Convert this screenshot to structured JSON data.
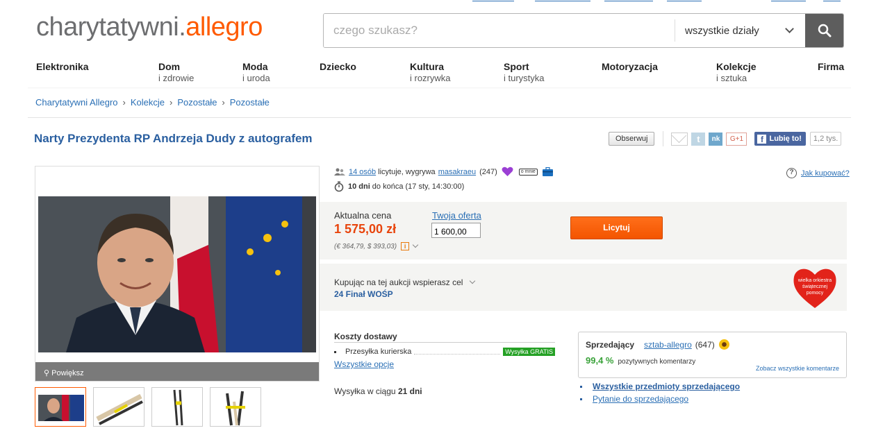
{
  "logo": {
    "part1": "charytatywni.",
    "part2": "allegro"
  },
  "search": {
    "placeholder": "czego szukasz?",
    "department": "wszystkie działy"
  },
  "categories": [
    {
      "title": "Elektronika",
      "sub": ""
    },
    {
      "title": "Dom",
      "sub": "i zdrowie"
    },
    {
      "title": "Moda",
      "sub": "i uroda"
    },
    {
      "title": "Dziecko",
      "sub": ""
    },
    {
      "title": "Kultura",
      "sub": "i rozrywka"
    },
    {
      "title": "Sport",
      "sub": "i turystyka"
    },
    {
      "title": "Motoryzacja",
      "sub": ""
    },
    {
      "title": "Kolekcje",
      "sub": "i sztuka"
    },
    {
      "title": "Firma",
      "sub": ""
    }
  ],
  "breadcrumb": [
    "Charytatywni Allegro",
    "Kolekcje",
    "Pozostałe",
    "Pozostałe"
  ],
  "item": {
    "title": "Narty Prezydenta RP Andrzeja Dudy z autografem"
  },
  "share": {
    "follow": "Obserwuj",
    "twitter": "t",
    "nk": "nk",
    "gplus": "G+1",
    "fb_like": "Lubię to!",
    "fb_count": "1,2 tys."
  },
  "gallery": {
    "zoom": "Powiększ"
  },
  "auction": {
    "bidders": "14 osób",
    "bidders_text": "licytuje, wygrywa",
    "winner": "masakraeu",
    "winner_rating": "(247)",
    "about_me": "o mnie",
    "days": "10 dni",
    "time_text": "do końca (17 sty, 14:30:00)",
    "help": "Jak kupować?"
  },
  "price": {
    "label": "Aktualna cena",
    "value": "1 575,00 zł",
    "converted": "(€ 364,79, $ 393,03)",
    "offer_label": "Twoja oferta",
    "offer_value": "1 600,00",
    "bid_button": "Licytuj"
  },
  "charity": {
    "text": "Kupując na tej aukcji wspierasz cel",
    "cause": "24 Finał WOŚP",
    "logo_text": "wielka orkiestra świątecznej pomocy"
  },
  "shipping": {
    "header": "Koszty dostawy",
    "method": "Przesyłka kurierska",
    "free_badge": "Wysyłka GRATIS",
    "all_options": "Wszystkie opcje",
    "ship_time_prefix": "Wysyłka w ciągu",
    "ship_time_value": "21 dni"
  },
  "seller": {
    "label": "Sprzedający",
    "name": "sztab-allegro",
    "rating": "(647)",
    "positive_pct": "99,4 %",
    "positive_text": "pozytywnych komentarzy",
    "all_comments": "Zobacz wszystkie komentarze",
    "all_items": "Wszystkie przedmioty sprzedającego",
    "ask": "Pytanie do sprzedającego"
  }
}
